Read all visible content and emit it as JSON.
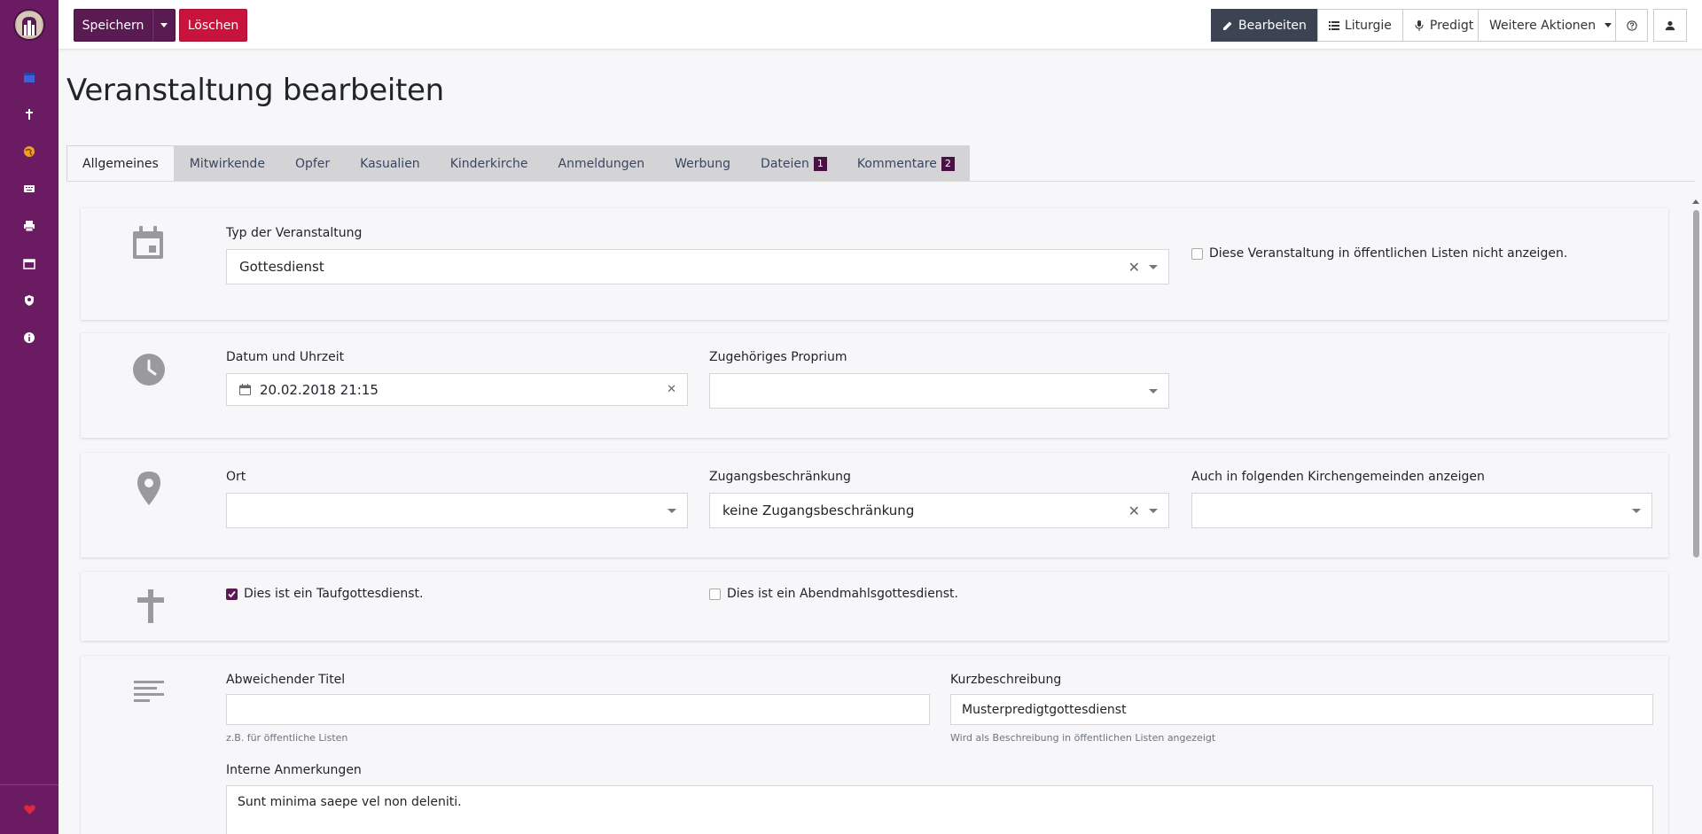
{
  "toolbar": {
    "save_label": "Speichern",
    "delete_label": "Löschen",
    "edit_label": "Bearbeiten",
    "liturgy_label": "Liturgie",
    "sermon_label": "Predigt",
    "more_actions_label": "Weitere Aktionen"
  },
  "page": {
    "title": "Veranstaltung bearbeiten"
  },
  "tabs": [
    {
      "label": "Allgemeines"
    },
    {
      "label": "Mitwirkende"
    },
    {
      "label": "Opfer"
    },
    {
      "label": "Kasualien"
    },
    {
      "label": "Kinderkirche"
    },
    {
      "label": "Anmeldungen"
    },
    {
      "label": "Werbung"
    },
    {
      "label": "Dateien",
      "badge": "1"
    },
    {
      "label": "Kommentare",
      "badge": "2"
    }
  ],
  "type_card": {
    "label": "Typ der Veranstaltung",
    "value": "Gottesdienst",
    "hide_public_label": "Diese Veranstaltung in öffentlichen Listen nicht anzeigen."
  },
  "date_card": {
    "date_label": "Datum und Uhrzeit",
    "date_value": "20.02.2018 21:15",
    "proprium_label": "Zugehöriges Proprium",
    "proprium_value": ""
  },
  "location_card": {
    "location_label": "Ort",
    "location_value": "",
    "access_label": "Zugangsbeschränkung",
    "access_value": "keine Zugangsbeschränkung",
    "parishes_label": "Auch in folgenden Kirchengemeinden anzeigen",
    "parishes_value": ""
  },
  "service_card": {
    "baptism_label": "Dies ist ein Taufgottesdienst.",
    "baptism_checked": true,
    "communion_label": "Dies ist ein Abendmahlsgottesdienst.",
    "communion_checked": false
  },
  "description_card": {
    "alt_title_label": "Abweichender Titel",
    "alt_title_value": "",
    "alt_title_hint": "z.B. für öffentliche Listen",
    "short_desc_label": "Kurzbeschreibung",
    "short_desc_value": "Musterpredigtgottesdienst",
    "short_desc_hint": "Wird als Beschreibung in öffentlichen Listen angezeigt",
    "notes_label": "Interne Anmerkungen",
    "notes_value": "Sunt minima saepe vel non deleniti."
  },
  "colors": {
    "sidebar": "#6a1b61",
    "primary": "#5a1a52",
    "danger": "#c8133c",
    "active_button": "#3c4454"
  }
}
